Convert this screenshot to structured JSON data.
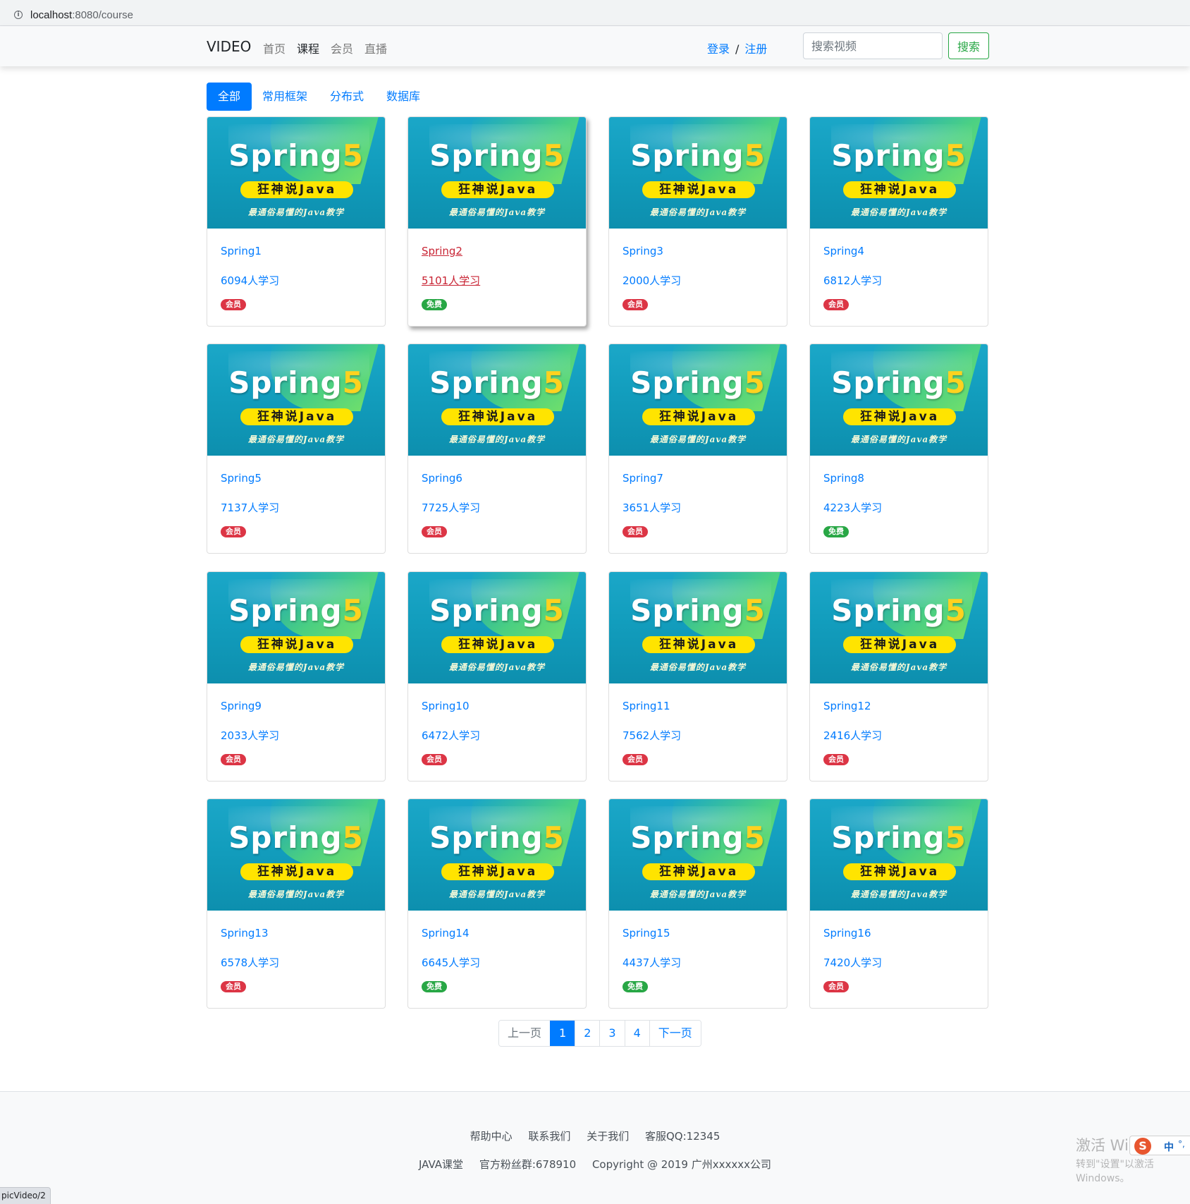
{
  "browser": {
    "url_host": "localhost",
    "url_rest": ":8080/course"
  },
  "navbar": {
    "brand": "VIDEO",
    "links": [
      "首页",
      "课程",
      "会员",
      "直播"
    ],
    "login": "登录",
    "separator": "/",
    "register": "注册",
    "search_placeholder": "搜索视频",
    "search_button": "搜索"
  },
  "categories": [
    "全部",
    "常用框架",
    "分布式",
    "数据库"
  ],
  "thumbnail": {
    "title_main": "Spring",
    "title_num": "5",
    "ribbon": "狂神说Java",
    "slogan": "最通俗易懂的Java教学"
  },
  "courses": [
    {
      "name": "Spring1",
      "learners": "6094人学习",
      "badge": "会员",
      "badge_color": "#dc3545"
    },
    {
      "name": "Spring2",
      "learners": "5101人学习",
      "badge": "免费",
      "badge_color": "#28a745"
    },
    {
      "name": "Spring3",
      "learners": "2000人学习",
      "badge": "会员",
      "badge_color": "#dc3545"
    },
    {
      "name": "Spring4",
      "learners": "6812人学习",
      "badge": "会员",
      "badge_color": "#dc3545"
    },
    {
      "name": "Spring5",
      "learners": "7137人学习",
      "badge": "会员",
      "badge_color": "#dc3545"
    },
    {
      "name": "Spring6",
      "learners": "7725人学习",
      "badge": "会员",
      "badge_color": "#dc3545"
    },
    {
      "name": "Spring7",
      "learners": "3651人学习",
      "badge": "会员",
      "badge_color": "#dc3545"
    },
    {
      "name": "Spring8",
      "learners": "4223人学习",
      "badge": "免费",
      "badge_color": "#28a745"
    },
    {
      "name": "Spring9",
      "learners": "2033人学习",
      "badge": "会员",
      "badge_color": "#dc3545"
    },
    {
      "name": "Spring10",
      "learners": "6472人学习",
      "badge": "会员",
      "badge_color": "#dc3545"
    },
    {
      "name": "Spring11",
      "learners": "7562人学习",
      "badge": "会员",
      "badge_color": "#dc3545"
    },
    {
      "name": "Spring12",
      "learners": "2416人学习",
      "badge": "会员",
      "badge_color": "#dc3545"
    },
    {
      "name": "Spring13",
      "learners": "6578人学习",
      "badge": "会员",
      "badge_color": "#dc3545"
    },
    {
      "name": "Spring14",
      "learners": "6645人学习",
      "badge": "免费",
      "badge_color": "#28a745"
    },
    {
      "name": "Spring15",
      "learners": "4437人学习",
      "badge": "免费",
      "badge_color": "#28a745"
    },
    {
      "name": "Spring16",
      "learners": "7420人学习",
      "badge": "会员",
      "badge_color": "#dc3545"
    }
  ],
  "pagination": {
    "prev": "上一页",
    "pages": [
      "1",
      "2",
      "3",
      "4"
    ],
    "current": "1",
    "next": "下一页"
  },
  "footer": {
    "links": [
      "帮助中心",
      "联系我们",
      "关于我们",
      "客服QQ:12345"
    ],
    "info": [
      "JAVA课堂",
      "官方粉丝群:678910",
      "Copyright @ 2019 广州xxxxxx公司"
    ]
  },
  "statusbar": {
    "text": "picVideo/2"
  },
  "watermark": {
    "line1": "激活 Windows",
    "line2": "转到\"设置\"以激活 Windows。"
  },
  "ime": {
    "logo": "S",
    "lang": "中",
    "dots": "°,"
  }
}
